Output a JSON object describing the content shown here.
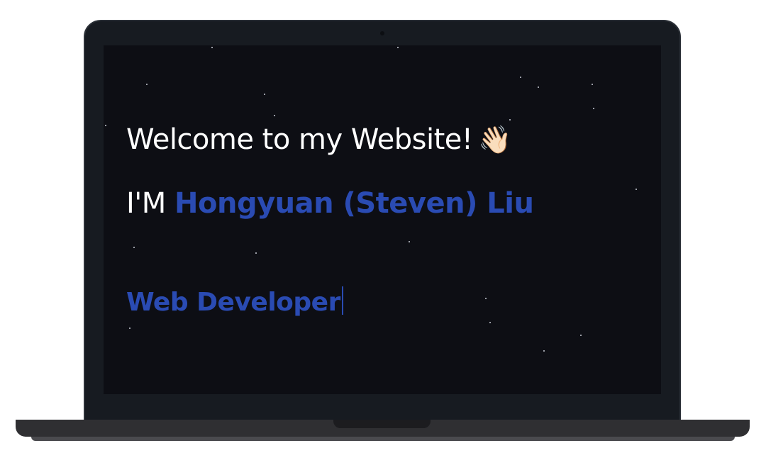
{
  "hero": {
    "welcome_text": "Welcome to my Website!",
    "wave_emoji": "👋🏻",
    "intro_prefix": "I'M",
    "name": "Hongyuan (Steven) Liu",
    "role": "Web Developer"
  },
  "icons": {
    "wave": "waving-hand-icon"
  },
  "colors": {
    "screen_background": "#0d0e14",
    "accent_blue": "#2a4bb3",
    "text_white": "#ffffff",
    "laptop_bezel": "#171b21",
    "laptop_base": "#2f2f32"
  }
}
